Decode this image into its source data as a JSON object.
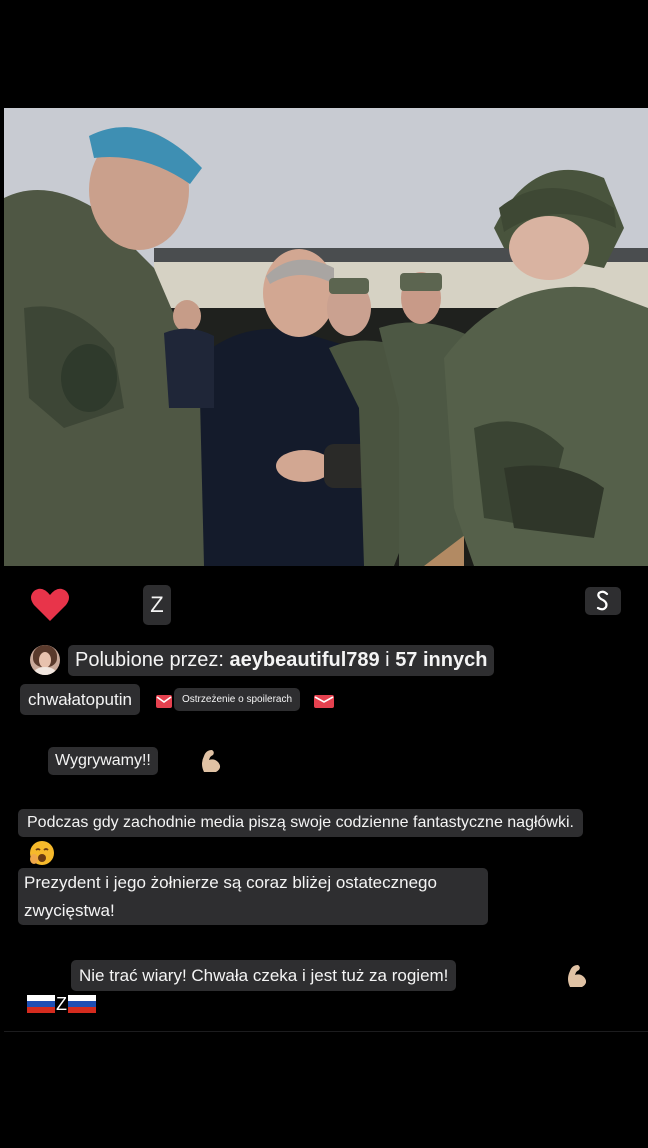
{
  "post": {
    "caption_tag": "Z",
    "likes": {
      "prefix": "Polubione przez: ",
      "user": "aeybeautiful789",
      "conjunction": " i ",
      "others": "57 innych"
    },
    "author": "chwałatoputin",
    "spoiler_label": "Ostrzeżenie o spoilerach",
    "lines": [
      "Wygrywamy!!",
      "Podczas gdy zachodnie media piszą swoje codzienne fantastyczne nagłówki.",
      "Prezydent i jego żołnierze są coraz bliżej ostatecznego",
      "zwycięstwa!",
      "Nie trać wiary! Chwała czeka i jest tuż za rogiem!"
    ],
    "flag_tag": "Z"
  },
  "colors": {
    "heart": "#e8344a",
    "chip_bg": "#2e2e30",
    "background": "#000000"
  },
  "icons": [
    "heart-icon",
    "save-icon",
    "muscle-emoji",
    "yawn-emoji",
    "mail-emoji",
    "russia-flag"
  ]
}
